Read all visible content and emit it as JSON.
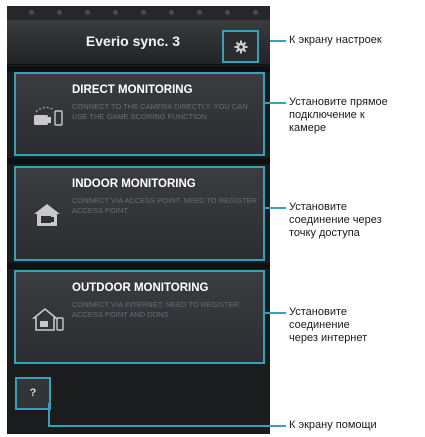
{
  "app": {
    "title": "Everio sync. 3",
    "settings_icon": "gear-icon",
    "help_label": "?"
  },
  "cards": [
    {
      "title": "DIRECT MONITORING",
      "description": "CONNECT TO THE CAMERA DIRECTLY. YOU CAN USE THE GAME SCORING FUNCTION.",
      "icon": "camera-phone-direct-icon"
    },
    {
      "title": "INDOOR MONITORING",
      "description": "CONNECT VIA ACCESS POINT. NEED TO REGISTER ACCESS POINT.",
      "icon": "house-camera-icon"
    },
    {
      "title": "OUTDOOR MONITORING",
      "description": "CONNECT VIA INTERNET. NEED TO REGISTER ACCESS POINT AND DDNS",
      "icon": "house-phone-icon"
    }
  ],
  "annotations": {
    "settings": "К экрану настроек",
    "direct": [
      "Установите прямое",
      "подключение к",
      "камере"
    ],
    "indoor": [
      "Установите",
      "соединение через",
      "точку доступа"
    ],
    "outdoor": [
      "Установите",
      "соединение",
      "через интернет"
    ],
    "help": "К экрану помощи"
  },
  "colors": {
    "highlight": "#3aa0b8",
    "background": "#1b1c1e",
    "card": "#333438"
  }
}
